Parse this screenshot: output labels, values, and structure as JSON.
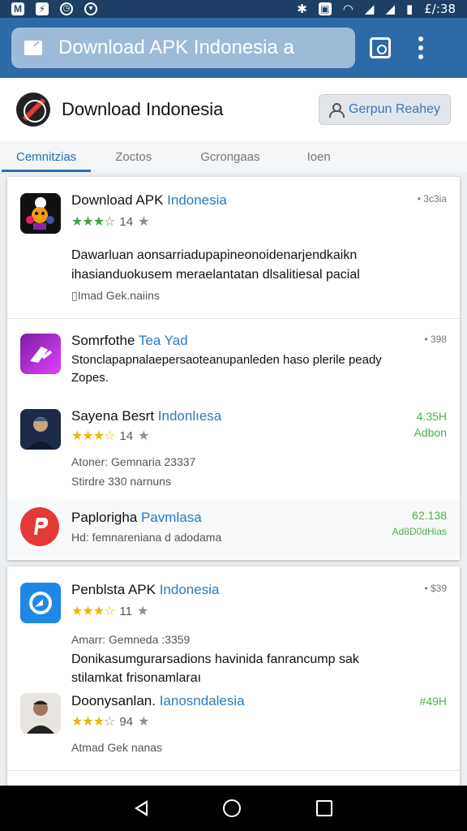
{
  "status_bar": {
    "time": "£/:38",
    "left_icons": [
      "mail-icon",
      "flash-icon",
      "clock-icon",
      "shield-icon"
    ],
    "right_icons": [
      "bluetooth-icon",
      "vibrate-icon",
      "wifi-icon",
      "signal-icon",
      "signal-icon-2",
      "battery-icon"
    ]
  },
  "app_bar": {
    "url_title": "Download APK Indonesia a",
    "colors": {
      "bar": "#2d6aa8",
      "omnibox": "#9dbbd9"
    }
  },
  "site_header": {
    "title": "Download Indonesia",
    "button_label": "Gerpun Reahey"
  },
  "tabs": [
    {
      "label": "Cemnitzias",
      "active": true
    },
    {
      "label": "Zoctos",
      "active": false
    },
    {
      "label": "Gcrongaas",
      "active": false
    },
    {
      "label": "Ioen",
      "active": false
    }
  ],
  "card1": {
    "items": [
      {
        "name": "Download APK",
        "name_accent": "Indonesia",
        "rating_num": "14",
        "side": "• 3c3ia",
        "desc_line1": "Dawarluan aonsarriadupapineonoidenarjendkaikn",
        "desc_line2": "ihasianduokusem meraelantatan dlsalitiesal pacial",
        "meta": "Imad Gek.naiins"
      },
      {
        "name": "Somrfothe",
        "name_accent": "Tea Yad",
        "side": "• 398",
        "desc_line1": "Stonclapapnalaepersaoteanupanleden haso plerile peady",
        "desc_line2": "Zopes."
      },
      {
        "name": "Sayena Besrt",
        "name_accent": "Indonlıesa",
        "rating_num": "14",
        "side_line1": "4.35H",
        "side_line2": "Adbon",
        "meta_line1": "Atoner: Gemnaria 23337",
        "meta_line2": "Stirdre 330 narnuns"
      },
      {
        "name": "Paplorigha",
        "name_accent": "Pavmlasa",
        "meta": "Hd: femnareniana d adodama",
        "side_line1": "62.138",
        "side_line2": "Ad8D0dHias"
      }
    ]
  },
  "card2": {
    "items": [
      {
        "name": "Penblsta APK",
        "name_accent": "Indonesia",
        "rating_num": "11",
        "side": "• $39",
        "meta": "Amarr: Gemneda :3359",
        "desc_line1": "Donikasumgurarsadions havinida fanrancump sak",
        "desc_line2": "stilamkat frisonamlaraı"
      },
      {
        "name": "Doonysanlan.",
        "name_accent": "Ianosndalesia",
        "rating_num": "94",
        "side": "#49H",
        "meta": "Atmad Gek nanas"
      }
    ]
  },
  "nav_bar": {
    "buttons": [
      "back-icon",
      "home-icon",
      "recents-icon"
    ]
  }
}
